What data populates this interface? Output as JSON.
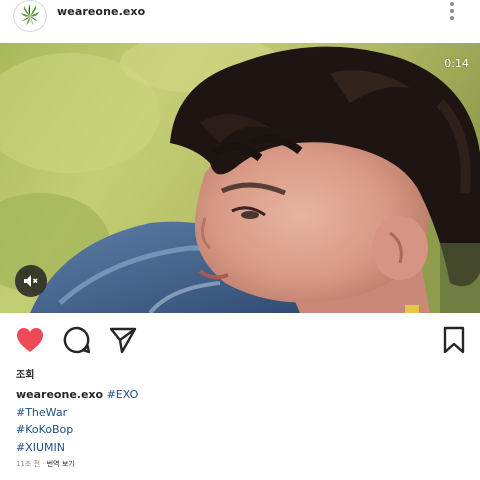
{
  "header": {
    "username": "weareone.exo",
    "avatar_icon": "leaf-logo-icon",
    "more_icon": "more-vertical-icon"
  },
  "video": {
    "timer": "0:14",
    "mute_icon": "speaker-muted-icon"
  },
  "actions": {
    "like_icon": "heart-filled-icon",
    "comment_icon": "comment-icon",
    "share_icon": "send-icon",
    "save_icon": "bookmark-icon",
    "like_color": "#ed4956"
  },
  "post": {
    "views_label": "조회",
    "caption_user": "weareone.exo",
    "hashtags": [
      "#EXO",
      "#TheWar",
      "#KoKoBop",
      "#XIUMIN"
    ],
    "time_ago": "11초 전",
    "separator": "·",
    "translate_label": "번역 보기"
  }
}
